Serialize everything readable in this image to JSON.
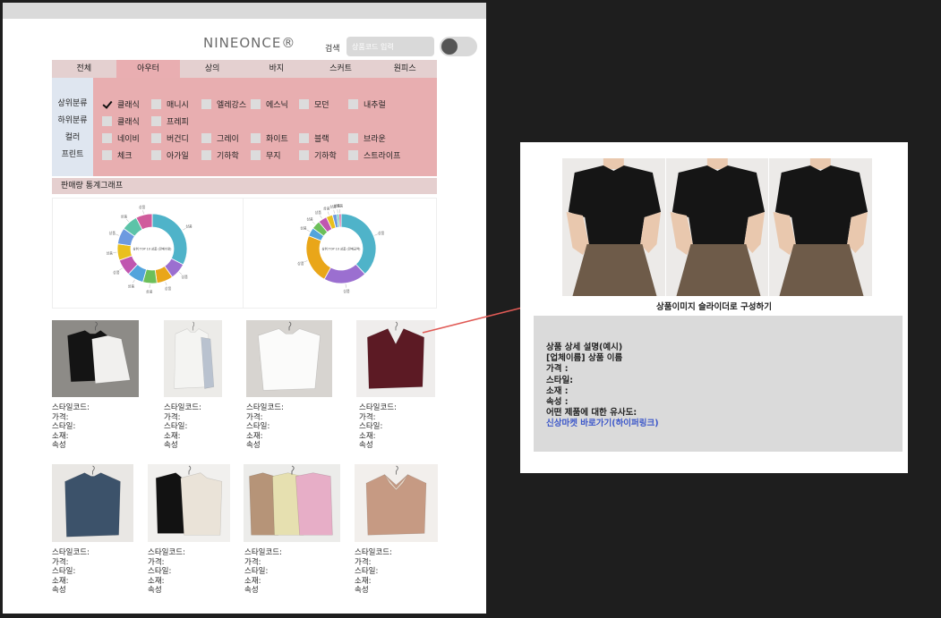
{
  "header": {
    "logo": "NINEONCE®",
    "search_label": "검색",
    "search_placeholder": "상품코드 입력"
  },
  "tabs": [
    "전체",
    "아우터",
    "상의",
    "바지",
    "스커트",
    "원피스"
  ],
  "active_tab": "아우터",
  "filters": [
    {
      "label": "상위분류",
      "options": [
        "클래식",
        "매니시",
        "엘레강스",
        "에스닉",
        "모던",
        "내추럴"
      ],
      "checked": [
        0
      ]
    },
    {
      "label": "하위분류",
      "options": [
        "클래식",
        "프레피"
      ],
      "checked": []
    },
    {
      "label": "컬러",
      "options": [
        "네이비",
        "버건디",
        "그레이",
        "화이트",
        "블랙",
        "브라운"
      ],
      "checked": []
    },
    {
      "label": "프린트",
      "options": [
        "체크",
        "아가일",
        "기하학",
        "무지",
        "기하학",
        "스트라이프"
      ],
      "checked": []
    }
  ],
  "stats_title": "판매량 통계그래프",
  "chart_data": [
    {
      "type": "pie",
      "title": "상위 TOP 10 상품 (판매수량)",
      "slices": [
        {
          "label": "상품",
          "value": 30
        },
        {
          "label": "상품",
          "value": 7
        },
        {
          "label": "상품",
          "value": 7
        },
        {
          "label": "상품",
          "value": 6
        },
        {
          "label": "상품",
          "value": 7
        },
        {
          "label": "상품",
          "value": 7
        },
        {
          "label": "상품",
          "value": 7
        },
        {
          "label": "상품",
          "value": 7
        },
        {
          "label": "상품",
          "value": 7
        },
        {
          "label": "상품",
          "value": 7
        }
      ],
      "colors": [
        "#4fb3c9",
        "#9b6fd0",
        "#e9a619",
        "#6cbf5a",
        "#53a4dc",
        "#c056b0",
        "#e9c01f",
        "#6c9ae0",
        "#5cc3a8",
        "#d05c9c"
      ]
    },
    {
      "type": "pie",
      "title": "상위 TOP 10 상품 (판매금액)",
      "slices": [
        {
          "label": "상품",
          "value": 38
        },
        {
          "label": "상품",
          "value": 20
        },
        {
          "label": "상품",
          "value": 23
        },
        {
          "label": "상품",
          "value": 4
        },
        {
          "label": "상품",
          "value": 4
        },
        {
          "label": "상품",
          "value": 4
        },
        {
          "label": "상품",
          "value": 3
        },
        {
          "label": "상품",
          "value": 2
        },
        {
          "label": "상품",
          "value": 1
        },
        {
          "label": "상품",
          "value": 1
        }
      ],
      "colors": [
        "#4fb3c9",
        "#9b6fd0",
        "#e9a619",
        "#53a4dc",
        "#6cbf5a",
        "#c056b0",
        "#e9c01f",
        "#6c9ae0",
        "#5cc3a8",
        "#d05c9c"
      ]
    }
  ],
  "product_info_labels": [
    "스타일코드:",
    "가격:",
    "스타일:",
    "소재:",
    "속성"
  ],
  "products": [
    {
      "id": 1,
      "bg": "#8d8b87"
    },
    {
      "id": 2,
      "bg": "#ecebe8"
    },
    {
      "id": 3,
      "bg": "#d7d4d0"
    },
    {
      "id": 4,
      "bg": "#efedec"
    },
    {
      "id": 5,
      "bg": "#e9e7e4"
    },
    {
      "id": 6,
      "bg": "#f1f0ee"
    },
    {
      "id": 7,
      "bg": "#ececea"
    },
    {
      "id": 8,
      "bg": "#f2efec"
    }
  ],
  "detail": {
    "slider_caption": "상품이미지 슬라이더로 구성하기",
    "lines": [
      "상품 상세 설명(예시)",
      "[업체이름] 상품 이름",
      "가격 :",
      "스타일:",
      "소재 :",
      "속성 :",
      "어떤 제품에 대한 유사도:"
    ],
    "link": "신상마켓 바로가기(하이퍼링크)"
  },
  "colors": {
    "arrow": "#e05a55",
    "tab_bar": "#e4d0d0",
    "active_tab": "#e9aeb1",
    "filter_bg": "#e8aeb0",
    "filter_labels_bg": "#dfe6f0",
    "link": "#3c57c9"
  }
}
